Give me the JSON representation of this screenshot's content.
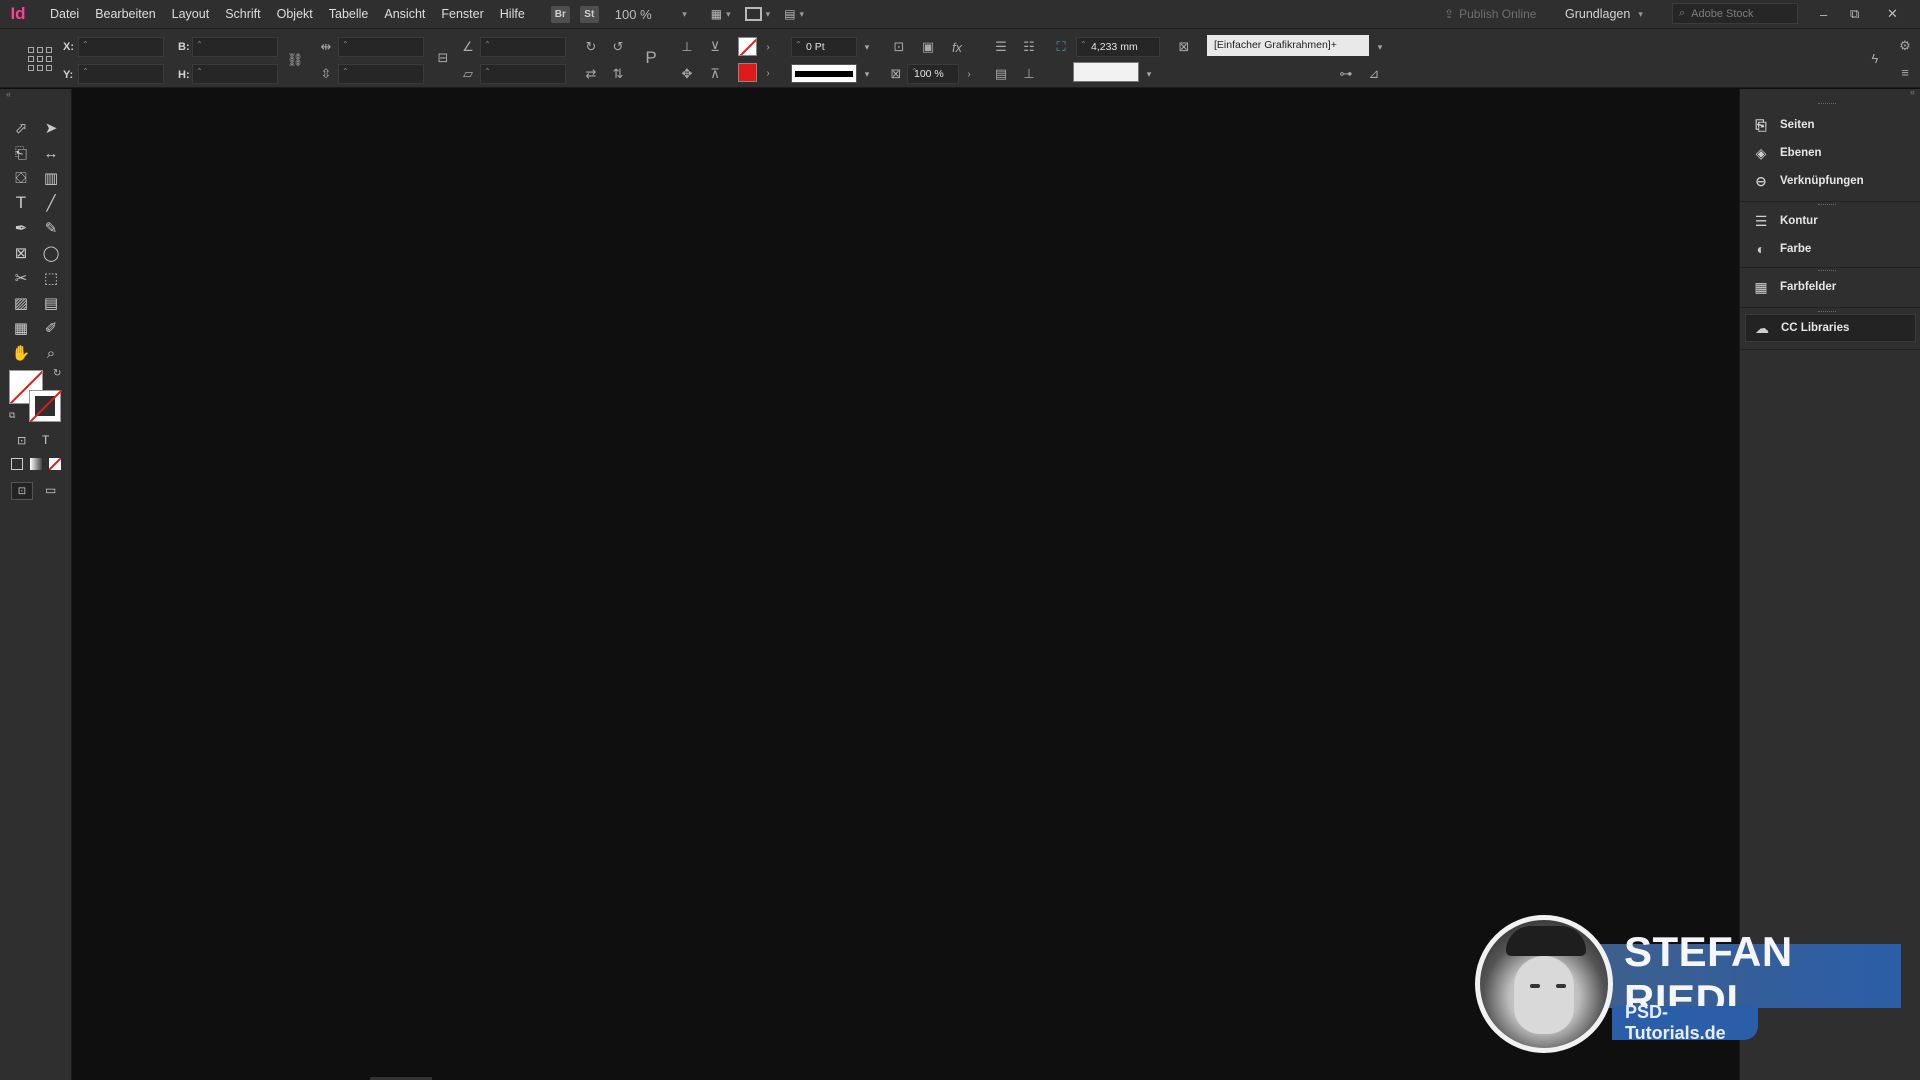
{
  "app": {
    "logo": "Id"
  },
  "menu": [
    "Datei",
    "Bearbeiten",
    "Layout",
    "Schrift",
    "Objekt",
    "Tabelle",
    "Ansicht",
    "Fenster",
    "Hilfe"
  ],
  "bridge": {
    "br": "Br",
    "st": "St"
  },
  "zoom": {
    "value": "100 %"
  },
  "publish": {
    "label": "Publish Online"
  },
  "workspace": {
    "label": "Grundlagen"
  },
  "stock_search": {
    "placeholder": "Adobe Stock"
  },
  "control": {
    "x_label": "X:",
    "y_label": "Y:",
    "w_label": "B:",
    "h_label": "H:",
    "stroke_weight": "0 Pt",
    "opacity": "100 %",
    "gap": "4,233 mm",
    "object_style": "[Einfacher Grafikrahmen]+"
  },
  "panels": [
    {
      "id": "seiten",
      "label": "Seiten",
      "icon": "pages-icon"
    },
    {
      "id": "ebenen",
      "label": "Ebenen",
      "icon": "layers-icon"
    },
    {
      "id": "verknuepfungen",
      "label": "Verknüpfungen",
      "icon": "links-icon"
    },
    {
      "id": "kontur",
      "label": "Kontur",
      "icon": "stroke-icon"
    },
    {
      "id": "farbe",
      "label": "Farbe",
      "icon": "color-icon"
    },
    {
      "id": "farbfelder",
      "label": "Farbfelder",
      "icon": "swatches-icon"
    },
    {
      "id": "cc",
      "label": "CC Libraries",
      "icon": "cc-libraries-icon"
    }
  ],
  "tools": {
    "format_t": "T",
    "icons": [
      "selection-tool-icon",
      "direct-selection-tool-icon",
      "page-tool-icon",
      "gap-tool-icon",
      "content-collector-icon",
      "content-placer-icon",
      "type-tool-icon",
      "line-tool-icon",
      "pen-tool-icon",
      "pencil-tool-icon",
      "rectangle-frame-tool-icon",
      "ellipse-tool-icon",
      "scissors-tool-icon",
      "free-transform-tool-icon",
      "gradient-swatch-tool-icon",
      "gradient-feather-tool-icon",
      "note-tool-icon",
      "eyedropper-tool-icon",
      "hand-tool-icon",
      "zoom-tool-icon"
    ]
  },
  "colors": {
    "accent": "#ff3e9a",
    "panel_bg": "#2f2f2f",
    "canvas_bg": "#0f0f0f",
    "stroke_red": "#e01919",
    "watermark_blue": "#2b5ea8"
  },
  "watermark": {
    "name": "STEFAN RIEDL",
    "site": "PSD-Tutorials.de"
  }
}
